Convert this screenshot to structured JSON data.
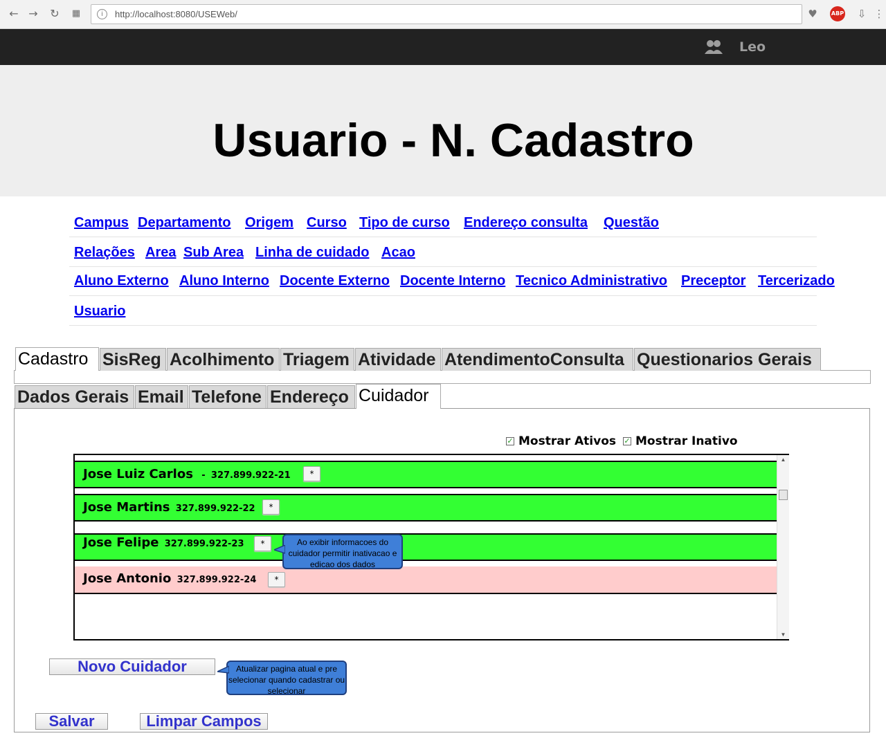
{
  "browser": {
    "url": "http://localhost:8080/USEWeb/"
  },
  "header": {
    "user_name": "Leo"
  },
  "hero": {
    "title": "Usuario - N. Cadastro"
  },
  "nav_rows": [
    [
      "Campus",
      "Departamento",
      "Origem",
      "Curso",
      "Tipo de curso",
      "Endereço consulta",
      "Questão"
    ],
    [
      "Relações",
      "Area",
      "Sub Area",
      "Linha de cuidado",
      "Acao"
    ],
    [
      "Aluno Externo",
      "Aluno Interno",
      "Docente Externo",
      "Docente Interno",
      "Tecnico Administrativo",
      "Preceptor",
      "Tercerizado"
    ],
    [
      "Usuario"
    ]
  ],
  "main_tabs": [
    "Cadastro",
    "SisReg",
    "Acolhimento",
    "Triagem",
    "Atividade",
    "AtendimentoConsulta",
    "Questionarios Gerais"
  ],
  "sub_tabs": [
    "Dados Gerais",
    "Email",
    "Telefone",
    "Endereço",
    "Cuidador"
  ],
  "filters": {
    "show_active_label": "Mostrar Ativos",
    "show_active_checked": true,
    "show_inactive_label": "Mostrar Inativo",
    "show_inactive_checked": true
  },
  "caregivers": [
    {
      "name": "Jose Luiz Carlos",
      "separator": "-",
      "cpf": "327.899.922-21",
      "button": "*",
      "status": "active"
    },
    {
      "name": "Jose Martins",
      "separator": "",
      "cpf": "327.899.922-22",
      "button": "*",
      "status": "active"
    },
    {
      "name": "Jose Felipe",
      "separator": "",
      "cpf": "327.899.922-23",
      "button": "*",
      "status": "active"
    },
    {
      "name": "Jose Antonio",
      "separator": "",
      "cpf": "327.899.922-24",
      "button": "*",
      "status": "inactive"
    }
  ],
  "notes": {
    "caregiver_info": "Ao exibir informacoes do cuidador permitir inativacao e edicao dos dados",
    "new_caregiver": "Atualizar pagina atual e pre selecionar quando cadastrar ou selecionar"
  },
  "buttons": {
    "new_caregiver": "Novo Cuidador",
    "save": "Salvar",
    "clear": "Limpar Campos"
  },
  "colors": {
    "active_row": "#33ff33",
    "inactive_row": "#ffcccc",
    "link": "#0000ee",
    "callout": "#3f7fd8"
  }
}
